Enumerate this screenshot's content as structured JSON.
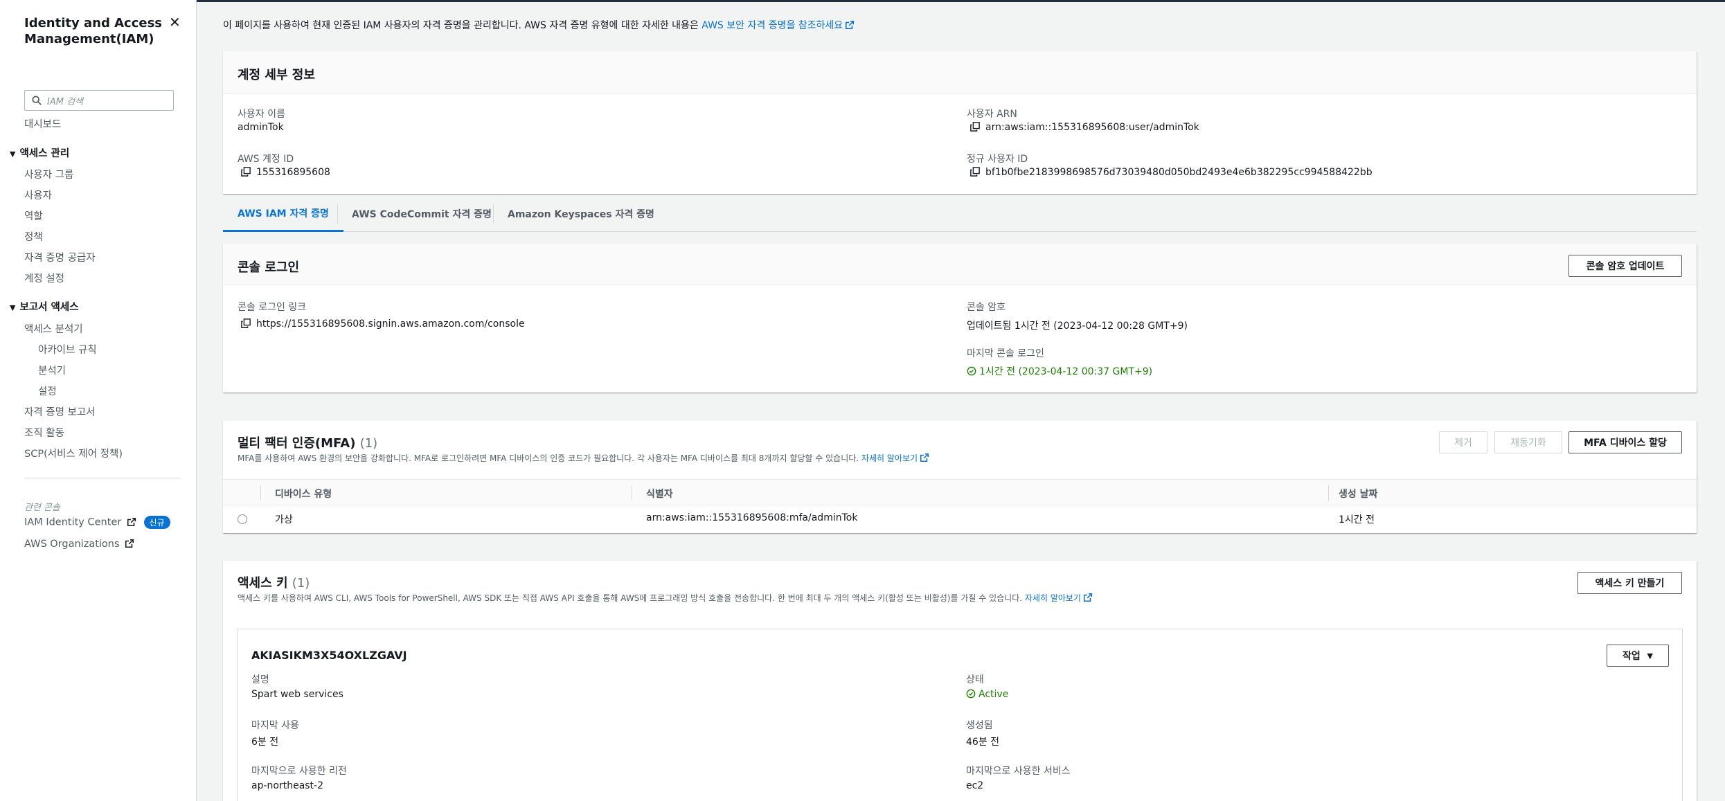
{
  "sidebar": {
    "title": "Identity and Access Management(IAM)",
    "search_placeholder": "IAM 검색",
    "dashboard": "대시보드",
    "access_mgmt": {
      "label": "액세스 관리",
      "items": [
        "사용자 그룹",
        "사용자",
        "역할",
        "정책",
        "자격 증명 공급자",
        "계정 설정"
      ]
    },
    "access_reports": {
      "label": "보고서 액세스",
      "analyzer": "액세스 분석기",
      "analyzer_sub": [
        "아카이브 규칙",
        "분석기",
        "설정"
      ],
      "items": [
        "자격 증명 보고서",
        "조직 활동",
        "SCP(서비스 제어 정책)"
      ]
    },
    "related_label": "관련 콘솔",
    "identity_center": "IAM Identity Center",
    "new_badge": "신규",
    "organizations": "AWS Organizations"
  },
  "intro": {
    "text": "이 페이지를 사용하여 현재 인증된 IAM 사용자의 자격 증명을 관리합니다. AWS 자격 증명 유형에 대한 자세한 내용은 ",
    "link": "AWS 보안 자격 증명을 참조하세요"
  },
  "account": {
    "title": "계정 세부 정보",
    "username_label": "사용자 이름",
    "username": "adminTok",
    "account_id_label": "AWS 계정 ID",
    "account_id": "155316895608",
    "arn_label": "사용자 ARN",
    "arn": "arn:aws:iam::155316895608:user/adminTok",
    "canonical_label": "정규 사용자 ID",
    "canonical": "bf1b0fbe2183998698576d73039480d050bd2493e4e6b382295cc994588422bb"
  },
  "tabs": [
    "AWS IAM 자격 증명",
    "AWS CodeCommit 자격 증명",
    "Amazon Keyspaces 자격 증명"
  ],
  "console": {
    "title": "콘솔 로그인",
    "update_button": "콘솔 암호 업데이트",
    "link_label": "콘솔 로그인 링크",
    "link": "https://155316895608.signin.aws.amazon.com/console",
    "password_label": "콘솔 암호",
    "password_value": "업데이트됨 1시간 전 (2023-04-12 00:28 GMT+9)",
    "last_login_label": "마지막 콘솔 로그인",
    "last_login_value": "1시간 전 (2023-04-12 00:37 GMT+9)"
  },
  "mfa": {
    "title": "멀티 팩터 인증(MFA)",
    "count": "(1)",
    "desc": "MFA를 사용하여 AWS 환경의 보안을 강화합니다. MFA로 로그인하려면 MFA 디바이스의 인증 코드가 필요합니다. 각 사용자는 MFA 디바이스를 최대 8개까지 할당할 수 있습니다. ",
    "learn_more": "자세히 알아보기",
    "remove_button": "제거",
    "resync_button": "재동기화",
    "assign_button": "MFA 디바이스 할당",
    "columns": [
      "디바이스 유형",
      "식별자",
      "생성 날짜"
    ],
    "rows": [
      {
        "type": "가상",
        "identifier": "arn:aws:iam::155316895608:mfa/adminTok",
        "created": "1시간 전"
      }
    ]
  },
  "access_keys": {
    "title": "액세스 키",
    "count": "(1)",
    "desc": "액세스 키를 사용하여 AWS CLI, AWS Tools for PowerShell, AWS SDK 또는 직접 AWS API 호출을 통해 AWS에 프로그래밍 방식 호출을 전송합니다. 한 번에 최대 두 개의 액세스 키(활성 또는 비활성)를 가질 수 있습니다. ",
    "learn_more": "자세히 알아보기",
    "create_button": "액세스 키 만들기",
    "key": {
      "id": "AKIASIKM3X54OXLZGAVJ",
      "actions_button": "작업",
      "desc_label": "설명",
      "desc_value": "Spart web services",
      "status_label": "상태",
      "status_value": "Active",
      "last_used_label": "마지막 사용",
      "last_used_value": "6분 전",
      "created_label": "생성됨",
      "created_value": "46분 전",
      "last_region_label": "마지막으로 사용한 리전",
      "last_region_value": "ap-northeast-2",
      "last_service_label": "마지막으로 사용한 서비스",
      "last_service_value": "ec2"
    }
  },
  "colors": {
    "accent": "#0972d3",
    "success": "#1d8102"
  }
}
